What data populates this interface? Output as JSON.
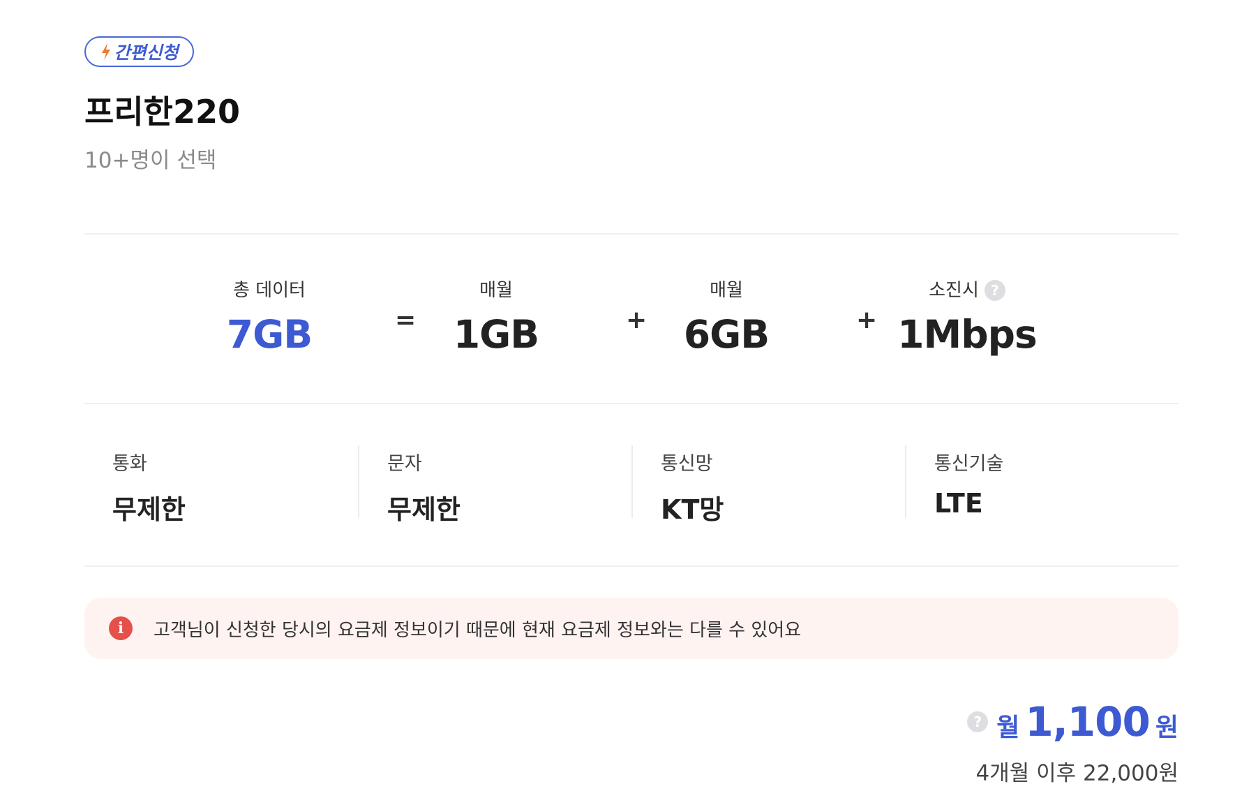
{
  "badge": {
    "label": "간편신청",
    "icon": "lightning-icon",
    "color": "#3d5ad3",
    "icon_color": "#f07a2a"
  },
  "plan": {
    "title": "프리한220",
    "picked": "10+명이 선택"
  },
  "data_breakdown": {
    "total_label": "총 데이터",
    "total_value": "7GB",
    "equals": "=",
    "plus": "+",
    "monthly_label": "매월",
    "monthly_value_1": "1GB",
    "monthly_value_2": "6GB",
    "exhausted_label": "소진시",
    "exhausted_value": "1Mbps",
    "help_icon": "question-icon"
  },
  "specs": [
    {
      "label": "통화",
      "value": "무제한"
    },
    {
      "label": "문자",
      "value": "무제한"
    },
    {
      "label": "통신망",
      "value": "KT망"
    },
    {
      "label": "통신기술",
      "value": "LTE"
    }
  ],
  "notice": {
    "icon": "info-icon",
    "icon_color": "#e5504a",
    "text": "고객님이 신청한 당시의 요금제 정보이기 때문에 현재 요금제 정보와는 다를 수 있어요"
  },
  "price": {
    "unit": "월",
    "amount": "1,100",
    "currency": "원",
    "after": "4개월 이후 22,000원",
    "color": "#3d5ad3"
  }
}
